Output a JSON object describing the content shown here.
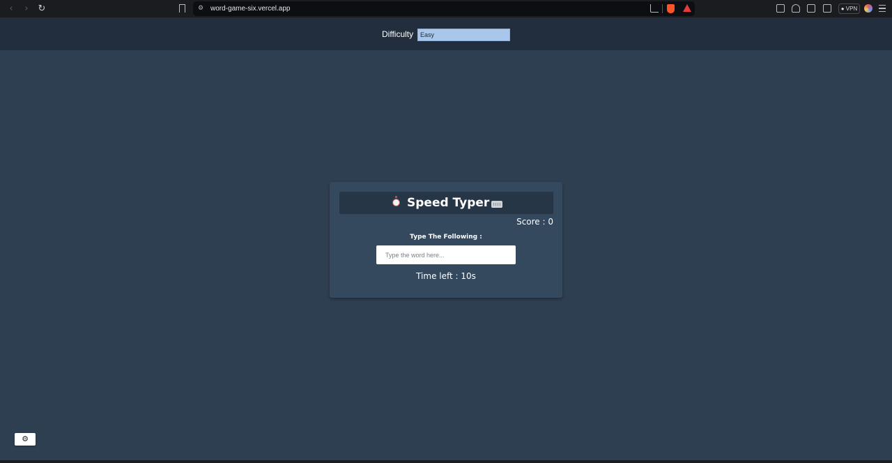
{
  "browser": {
    "url": "word-game-six.vercel.app",
    "vpn_label": "VPN"
  },
  "header": {
    "difficulty_label": "Difficulty",
    "difficulty_value": "Easy"
  },
  "game": {
    "title": "Speed Typer",
    "score_text": "Score : 0",
    "prompt_label": "Type The Following :",
    "input_placeholder": "Type the word here...",
    "time_text": "Time left : 10s"
  },
  "settings": {
    "icon": "gear-icon"
  },
  "colors": {
    "page_background": "#2f3f52",
    "header_background": "#222e3d",
    "card_background": "#34495e",
    "title_bar_background": "#273646",
    "select_background": "#a9c7eb"
  }
}
